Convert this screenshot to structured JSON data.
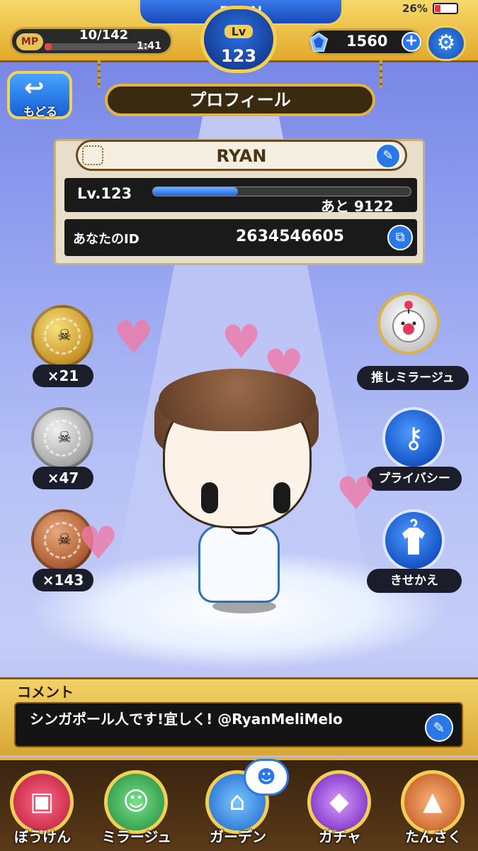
{
  "status": {
    "battery_percent": "26%"
  },
  "topbar": {
    "player_name": "RYAN",
    "mp_label": "MP",
    "mp_value": "10/142",
    "mp_fraction": 0.07,
    "mp_timer": "1:41",
    "level_label": "Lv",
    "level_value": "123",
    "gem_count": "1560",
    "plus_symbol": "+"
  },
  "back_button": {
    "label": "もどる"
  },
  "header": {
    "title": "プロフィール"
  },
  "profile": {
    "name": "RYAN",
    "level_text": "Lv.123",
    "xp_fraction": 0.33,
    "xp_remaining": "あと 9122",
    "id_label": "あなたのID",
    "id_value": "2634546605"
  },
  "medals": [
    {
      "tier": "gold",
      "count": "×21"
    },
    {
      "tier": "silver",
      "count": "×47"
    },
    {
      "tier": "bronze",
      "count": "×143"
    }
  ],
  "side_buttons": [
    {
      "icon": "moogle-icon",
      "label": "推しミラージュ"
    },
    {
      "icon": "key-icon",
      "label": "プライバシー"
    },
    {
      "icon": "shirt-icon",
      "label": "きせかえ"
    }
  ],
  "comment": {
    "label": "コメント",
    "text": "シンガポール人です!宜しく! @RyanMeliMelo"
  },
  "bottom_nav": [
    {
      "label": "ぼうけん",
      "icon": "adventure-icon",
      "color": "#d8304e"
    },
    {
      "label": "ミラージュ",
      "icon": "mirage-icon",
      "color": "#2fa84a"
    },
    {
      "label": "ガーデン",
      "icon": "garden-icon",
      "color": "#2a88e8"
    },
    {
      "label": "ガチャ",
      "icon": "gacha-icon",
      "color": "#8a3ad8"
    },
    {
      "label": "たんさく",
      "icon": "explore-icon",
      "color": "#c8641e"
    }
  ],
  "colors": {
    "accent_blue": "#1d66e0",
    "gold": "#f3cf55"
  }
}
